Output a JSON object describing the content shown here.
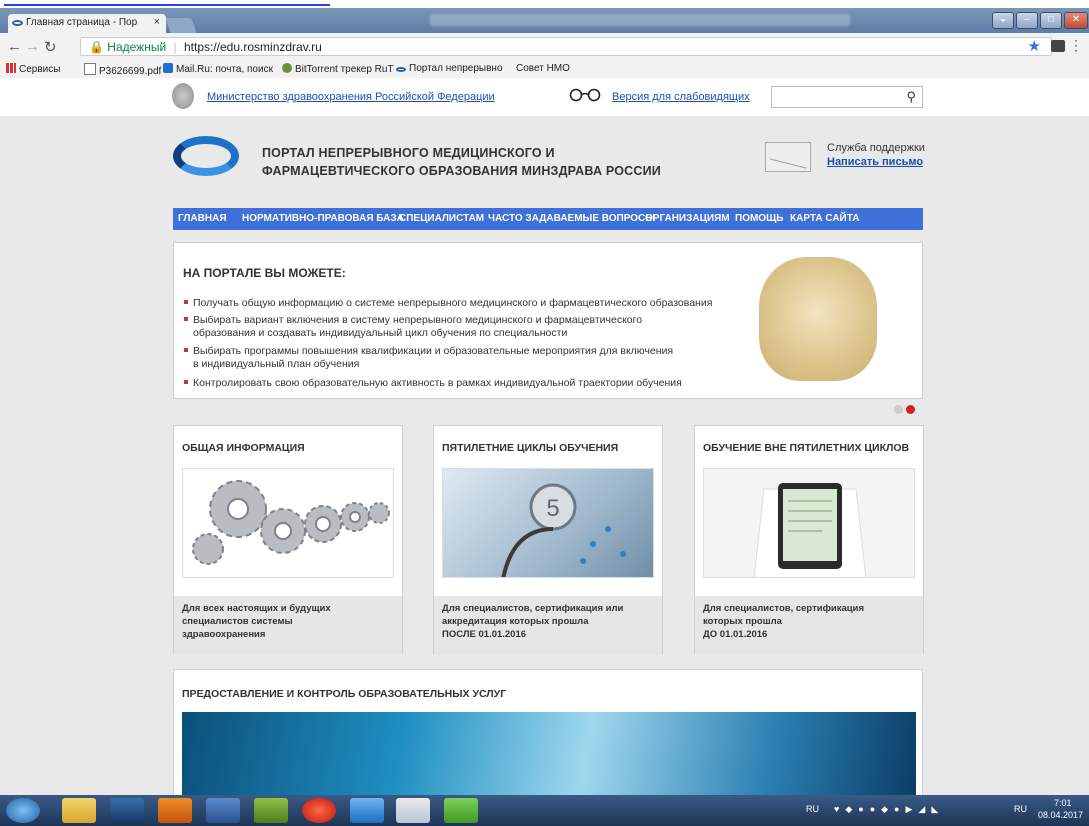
{
  "browser": {
    "tab_title": "Главная страница - Пор",
    "tab_close": "×",
    "url_secure_label": "Надежный",
    "url": "https://edu.rosminzdrav.ru",
    "bookmarks": [
      "Сервисы",
      "P3626699.pdf",
      "Mail.Ru: почта, поиск",
      "BitTorrent трекер RuT",
      "Портал непрерывно",
      "Совет НМО"
    ]
  },
  "ministry_bar": {
    "ministry_link": "Министерство здравоохранения Российской Федерации",
    "low_vision_link": "Версия для слабовидящих",
    "search_placeholder": ""
  },
  "header": {
    "title_line1": "ПОРТАЛ НЕПРЕРЫВНОГО МЕДИЦИНСКОГО И",
    "title_line2": "ФАРМАЦЕВТИЧЕСКОГО ОБРАЗОВАНИЯ МИНЗДРАВА РОССИИ",
    "support_label": "Служба поддержки",
    "write_letter": "Написать письмо"
  },
  "nav": [
    "ГЛАВНАЯ",
    "НОРМАТИВНО-ПРАВОВАЯ БАЗА",
    "СПЕЦИАЛИСТАМ",
    "ЧАСТО ЗАДАВАЕМЫЕ ВОПРОСЫ",
    "ОРГАНИЗАЦИЯМ",
    "ПОМОЩЬ",
    "КАРТА САЙТА"
  ],
  "slider": {
    "title": "НА ПОРТАЛЕ ВЫ МОЖЕТЕ:",
    "bullets": [
      [
        "Получать общую информацию о системе непрерывного медицинского и фармацевтического образования"
      ],
      [
        "Выбирать вариант включения в систему непрерывного медицинского и фармацевтического",
        "образования и создавать индивидуальный цикл обучения по специальности"
      ],
      [
        "Выбирать программы повышения квалификации и образовательные мероприятия для включения",
        "в индивидуальный план обучения"
      ],
      [
        "Контролировать свою образовательную активность в рамках индивидуальной траектории обучения"
      ]
    ],
    "active_dot": 2
  },
  "cards": [
    {
      "title": "ОБЩАЯ ИНФОРМАЦИЯ",
      "desc": [
        "Для всех настоящих и будущих",
        "специалистов системы",
        "здравоохранения"
      ],
      "icon": "gears-image"
    },
    {
      "title": "ПЯТИЛЕТНИЕ ЦИКЛЫ ОБУЧЕНИЯ",
      "desc": [
        "Для специалистов, сертификация или",
        "аккредитация которых прошла",
        "ПОСЛЕ 01.01.2016"
      ],
      "icon": "stethoscope-image",
      "badge": "5"
    },
    {
      "title": "ОБУЧЕНИЕ ВНЕ ПЯТИЛЕТНИХ ЦИКЛОВ",
      "desc": [
        "Для специалистов, сертификация",
        "которых прошла",
        "ДО 01.01.2016"
      ],
      "icon": "tablet-image"
    }
  ],
  "services": {
    "title": "ПРЕДОСТАВЛЕНИЕ И КОНТРОЛЬ ОБРАЗОВАТЕЛЬНЫХ УСЛУГ"
  },
  "taskbar": {
    "lang": "RU",
    "tray_lang": "RU",
    "time": "7:01",
    "date": "08.04.2017"
  },
  "colors": {
    "nav_blue": "#3f6fd8",
    "link_blue": "#1f4ea8",
    "bullet_red": "#c0392b",
    "page_bg": "#e9e9ea"
  }
}
